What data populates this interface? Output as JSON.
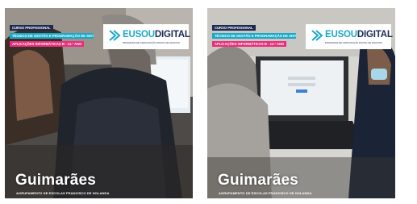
{
  "cards": [
    {
      "course_label": "CURSO PROFISSIONAL",
      "program_label": "TÉCNICO DE GESTÃO E PROGRAMAÇÃO DE SISTEMAS INFORMÁTICOS",
      "subject_label": "APLICAÇÕES INFORMÁTICAS B - 12.º ano",
      "logo_eu": "EUSOU",
      "logo_brand": "DIGITAL",
      "logo_tagline": "PROGRAMA DE CAPACITAÇÃO DIGITAL DE ADULTOS",
      "city": "Guimarães",
      "school": "AGRUPAMENTO DE ESCOLAS FRANCISCO DE HOLANDA"
    },
    {
      "course_label": "CURSO PROFISSIONAL",
      "program_label": "TÉCNICO DE GESTÃO E PROGRAMAÇÃO DE SISTEMAS INFORMÁTICOS",
      "subject_label": "APLICAÇÕES INFORMÁTICAS B - 12.º ano",
      "logo_eu": "EUSOU",
      "logo_brand": "DIGITAL",
      "logo_tagline": "PROGRAMA DE CAPACITAÇÃO DIGITAL DE ADULTOS",
      "city": "Guimarães",
      "school": "AGRUPAMENTO DE ESCOLAS FRANCISCO DE HOLANDA"
    }
  ],
  "colors": {
    "brand_navy": "#1b2a55",
    "brand_cyan": "#1aa8c9",
    "brand_magenta": "#ec2c7a"
  }
}
